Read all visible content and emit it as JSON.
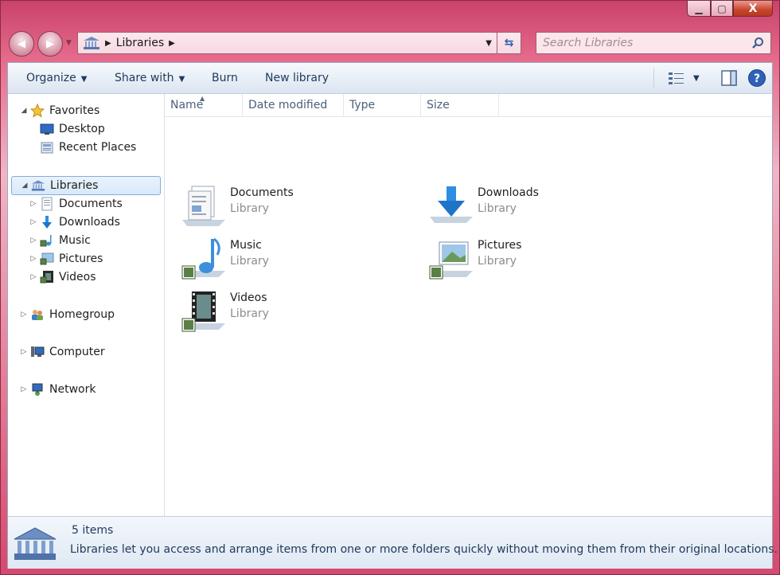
{
  "window": {
    "caption": {
      "minimize": "▁",
      "maximize": "▢",
      "close": "X"
    }
  },
  "address": {
    "segments": [
      "Libraries"
    ],
    "search_placeholder": "Search Libraries"
  },
  "toolbar": {
    "organize": "Organize",
    "share_with": "Share with",
    "burn": "Burn",
    "new_library": "New library"
  },
  "nav": {
    "favorites": {
      "label": "Favorites",
      "items": [
        "Desktop",
        "Recent Places"
      ]
    },
    "libraries": {
      "label": "Libraries",
      "items": [
        "Documents",
        "Downloads",
        "Music",
        "Pictures",
        "Videos"
      ]
    },
    "homegroup": "Homegroup",
    "computer": "Computer",
    "network": "Network"
  },
  "columns": [
    "Name",
    "Date modified",
    "Type",
    "Size"
  ],
  "libraries": [
    {
      "name": "Documents",
      "type": "Library",
      "icon": "documents-library-icon"
    },
    {
      "name": "Downloads",
      "type": "Library",
      "icon": "downloads-library-icon"
    },
    {
      "name": "Music",
      "type": "Library",
      "icon": "music-library-icon"
    },
    {
      "name": "Pictures",
      "type": "Library",
      "icon": "pictures-library-icon"
    },
    {
      "name": "Videos",
      "type": "Library",
      "icon": "videos-library-icon"
    }
  ],
  "details": {
    "count": "5 items",
    "description": "Libraries let you access and arrange items from one or more folders quickly without moving them from their original locations."
  },
  "colors": {
    "frame": "#d5496f",
    "selection": "#d8e9fb",
    "toolbar_text": "#1e395b"
  }
}
